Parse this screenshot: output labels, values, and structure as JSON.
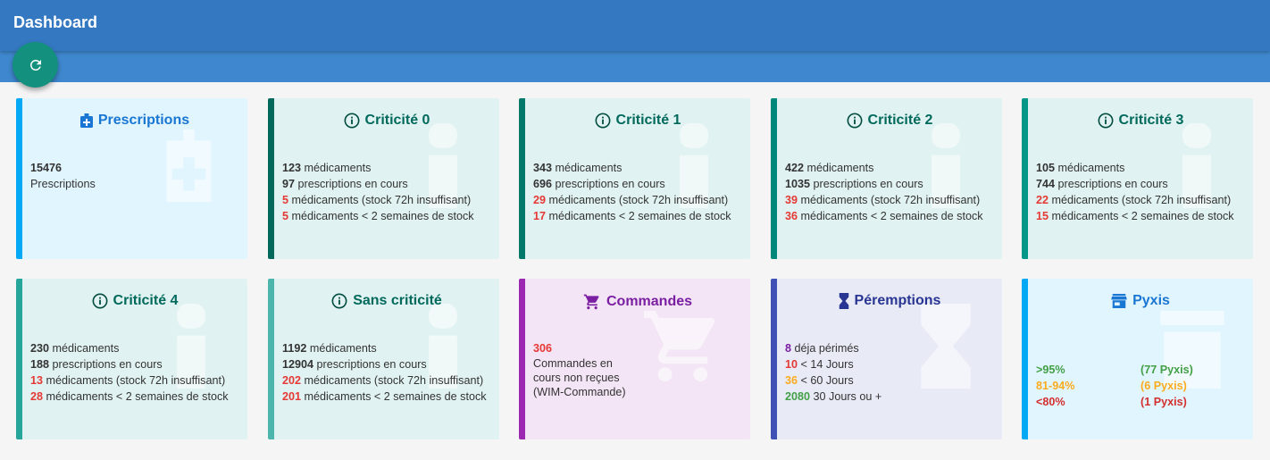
{
  "header": {
    "title": "Dashboard"
  },
  "colors": {
    "header": "#3478c1",
    "fab": "#14907f",
    "red": "#e53935",
    "green": "#43a047",
    "orange": "#fbab1e"
  },
  "cards": {
    "prescriptions": {
      "title": "Prescriptions",
      "count": "15476",
      "label": "Prescriptions"
    },
    "crit0": {
      "title": "Criticité 0",
      "meds": "123",
      "presc": "97",
      "stock72": "5",
      "twoweeks": "5"
    },
    "crit1": {
      "title": "Criticité 1",
      "meds": "343",
      "presc": "696",
      "stock72": "29",
      "twoweeks": "17"
    },
    "crit2": {
      "title": "Criticité 2",
      "meds": "422",
      "presc": "1035",
      "stock72": "39",
      "twoweeks": "36"
    },
    "crit3": {
      "title": "Criticité 3",
      "meds": "105",
      "presc": "744",
      "stock72": "22",
      "twoweeks": "15"
    },
    "crit4": {
      "title": "Criticité 4",
      "meds": "230",
      "presc": "188",
      "stock72": "13",
      "twoweeks": "28"
    },
    "sans": {
      "title": "Sans criticité",
      "meds": "1192",
      "presc": "12904",
      "stock72": "202",
      "twoweeks": "201"
    },
    "commandes": {
      "title": "Commandes",
      "count": "306",
      "label": "Commandes en cours non reçues (WIM-Commande)"
    },
    "peremptions": {
      "title": "Péremptions",
      "rows": [
        {
          "value": "8",
          "text": "déja périmés"
        },
        {
          "value": "10",
          "text": "< 14 Jours"
        },
        {
          "value": "36",
          "text": "< 60 Jours"
        },
        {
          "value": "2080",
          "text": "30 Jours ou +"
        }
      ]
    },
    "pyxis": {
      "title": "Pyxis",
      "rows": [
        {
          "range": ">95%",
          "count": "(77 Pyxis)"
        },
        {
          "range": "81-94%",
          "count": "(6 Pyxis)"
        },
        {
          "range": "<80%",
          "count": "(1 Pyxis)"
        }
      ]
    }
  },
  "labels": {
    "meds": "médicaments",
    "presc": "prescriptions en cours",
    "stock72": "médicaments (stock 72h insuffisant)",
    "twoweeks": "médicaments < 2 semaines de stock"
  }
}
